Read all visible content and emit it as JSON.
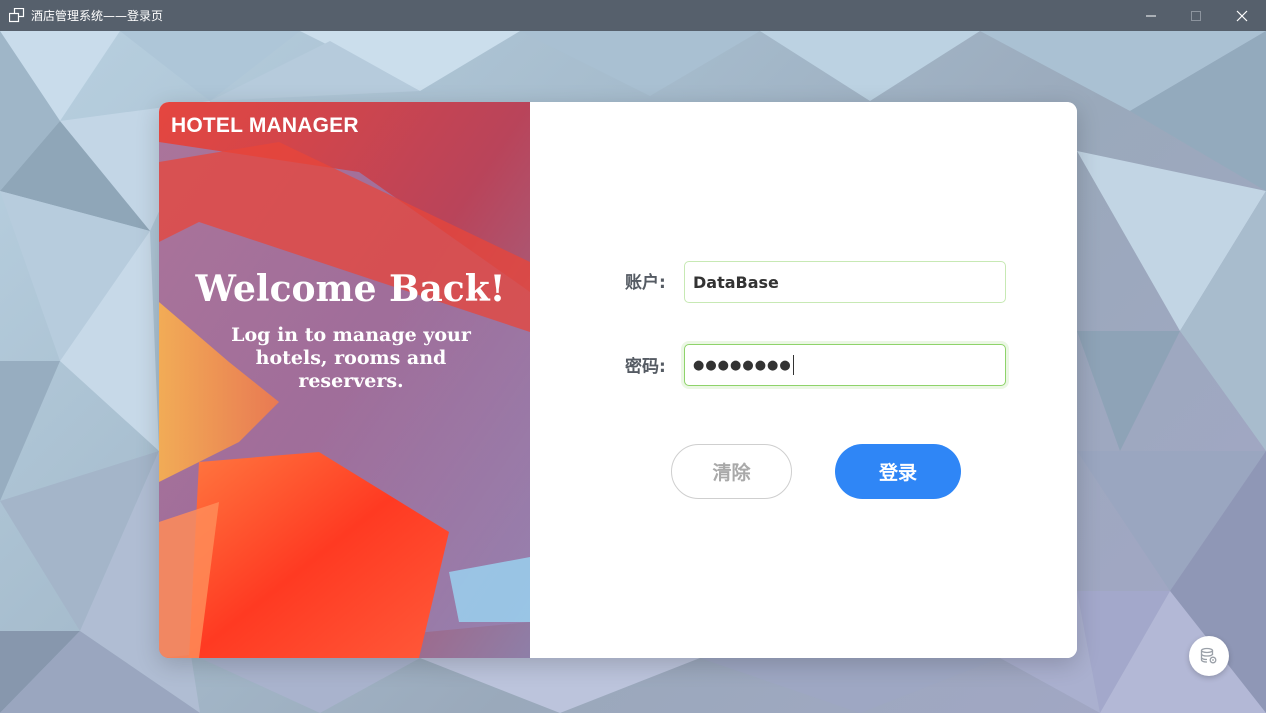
{
  "window": {
    "title": "酒店管理系统——登录页",
    "icon": "window-app-icon"
  },
  "left_panel": {
    "brand": "HOTEL MANAGER",
    "welcome": "Welcome Back!",
    "subtitle": "Log in to manage your hotels, rooms and reservers."
  },
  "form": {
    "account_label": "账户:",
    "account_value": "DataBase",
    "password_label": "密码:",
    "password_masked": "●●●●●●●●"
  },
  "buttons": {
    "clear": "清除",
    "login": "登录"
  },
  "colors": {
    "login_button": "#2f86f6",
    "focus_border": "#8ed36a",
    "titlebar": "#56606c"
  },
  "icons": {
    "database_settings": "database-settings-icon"
  }
}
